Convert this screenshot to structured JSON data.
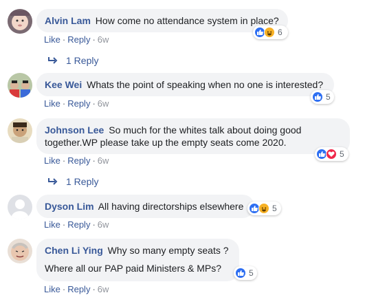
{
  "comments": [
    {
      "author": "Alvin Lam",
      "text": "How come no attendance system in place?",
      "reaction_count": "6",
      "reactions": [
        "like-icon",
        "haha-icon"
      ]
    },
    {
      "author": "Kee Wei",
      "text": "Whats the point of speaking when no one is interested?",
      "reaction_count": "5",
      "reactions": [
        "like-icon"
      ]
    },
    {
      "author": "Johnson Lee",
      "text_line1": "So much for the whites talk about doing good",
      "text_line2": "together.WP please take up the empty seats come 2020.",
      "reaction_count": "5",
      "reactions": [
        "like-icon",
        "love-icon"
      ]
    },
    {
      "author": "Dyson Lim",
      "text": "All having directorships elsewhere",
      "reaction_count": "5",
      "reactions": [
        "like-icon",
        "haha-icon"
      ]
    },
    {
      "author": "Chen Li Ying",
      "text_line1": "Why so many empty seats ?",
      "text_line2": "Where all our PAP paid Ministers & MPs?",
      "reaction_count": "5",
      "reactions": [
        "like-icon"
      ]
    }
  ],
  "actions": {
    "like": "Like",
    "reply": "Reply",
    "separator": "·",
    "time": "6w"
  },
  "replies": {
    "label": "1 Reply"
  },
  "colors": {
    "link": "#385898",
    "bubble": "#f2f3f5",
    "like": "#2e6ff2",
    "haha": "#f7b125",
    "love": "#f0284a"
  }
}
